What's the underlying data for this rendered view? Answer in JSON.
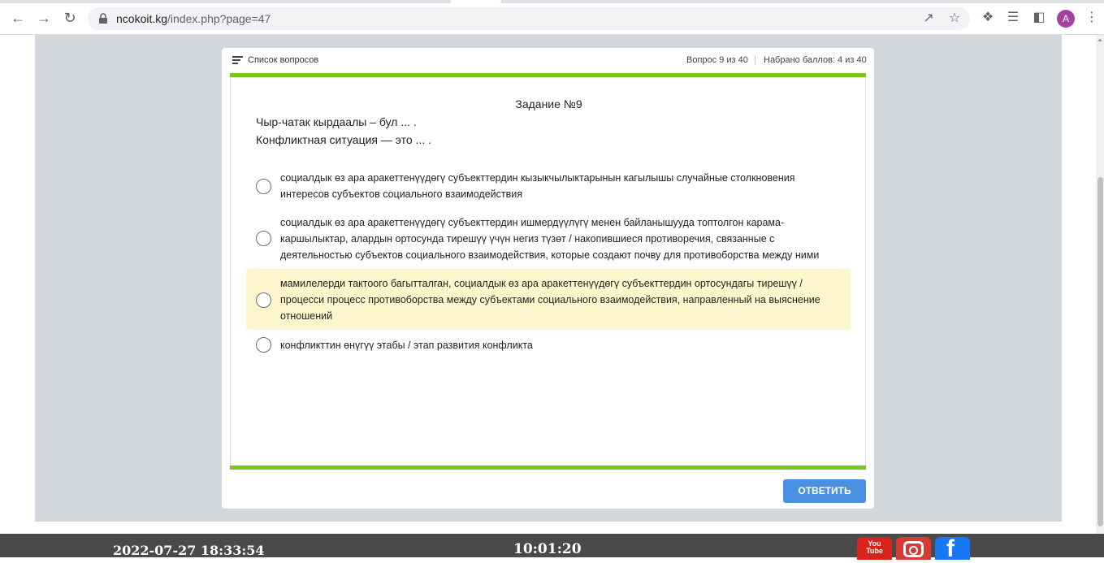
{
  "browser": {
    "url_host": "ncokoit.kg",
    "url_path": "/index.php?page=47",
    "avatar_letter": "A"
  },
  "header": {
    "list_label": "Список вопросов",
    "question_counter": "Вопрос 9 из 40",
    "score_counter": "Набрано баллов: 4 из 40"
  },
  "task": {
    "title": "Задание №9",
    "line1": "Чыр-чатак кырдаалы – бул ... .",
    "line2": "Конфликтная ситуация — это ... ."
  },
  "options": [
    {
      "line1": "социалдык   өз ара аракеттенүүдөгү субъекттердин кызыкчылыктарынын кагылышы     случайные столкновения",
      "line2": "интересов   субъектов социального взаимодействия",
      "line3": "",
      "highlighted": false
    },
    {
      "line1": "социалдык өз ара аракеттенүүдөгү субъекттердин ишмердүүлүгү менен байланышууда топтолгон карама-",
      "line2": "каршылыктар, алардын ортосунда тирешүү үчүн негиз түзөт / накопившиеся противоречия, связанные с",
      "line3": "деятельностью субъектов социального взаимодействия, которые создают почву для противоборства между ними",
      "highlighted": false
    },
    {
      "line1": "мамилелерди тактоого багытталган, социалдык өз ара аракеттенүүдөгү субъекттердин ортосундагы тирешүү /",
      "line2": "процесси процесс противоборства между субъектами социального взаимодействия, направленный на выяснение",
      "line3": "отношений",
      "highlighted": true
    },
    {
      "line1": "конфликттин өнүгүү этабы   / этап развития конфликта",
      "line2": "",
      "line3": "",
      "highlighted": false
    }
  ],
  "answer_button": "ОТВЕТИТЬ",
  "footer": {
    "datetime": "2022-07-27 18:33:54",
    "timer": "10:01:20",
    "youtube_label": "You Tube",
    "social": [
      "youtube-icon",
      "instagram-icon",
      "facebook-icon"
    ]
  },
  "colors": {
    "accent_green": "#7cc31c",
    "button_blue": "#4a90e2",
    "highlight": "#fdf6cc"
  }
}
